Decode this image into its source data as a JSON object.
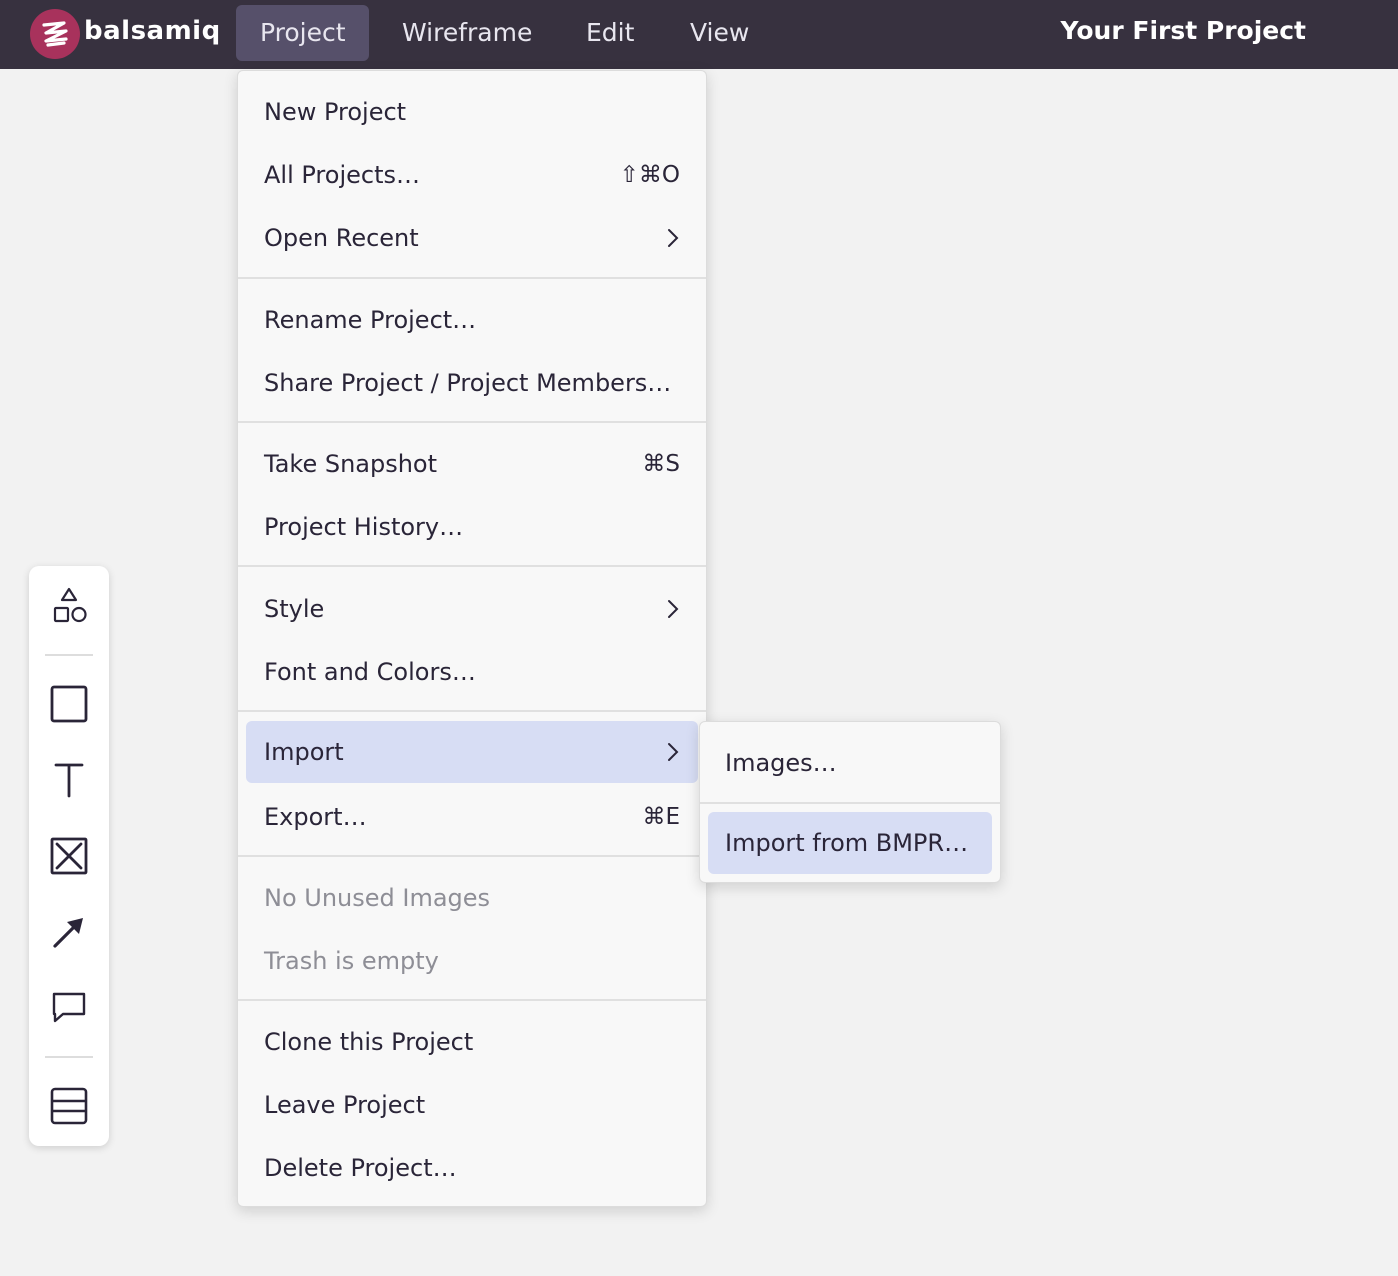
{
  "topbar": {
    "brand": "balsamiq",
    "menus": [
      "Project",
      "Wireframe",
      "Edit",
      "View"
    ],
    "active_menu": "Project",
    "project_title": "Your First Project"
  },
  "project_menu": {
    "new_project": "New Project",
    "all_projects": "All Projects…",
    "all_projects_shortcut": "⇧⌘O",
    "open_recent": "Open Recent",
    "rename_project": "Rename Project…",
    "share_project": "Share Project / Project Members…",
    "take_snapshot": "Take Snapshot",
    "take_snapshot_shortcut": "⌘S",
    "project_history": "Project History…",
    "style": "Style",
    "font_colors": "Font and Colors…",
    "import": "Import",
    "export": "Export…",
    "export_shortcut": "⌘E",
    "no_unused_images": "No Unused Images",
    "trash_empty": "Trash is empty",
    "clone_project": "Clone this Project",
    "leave_project": "Leave Project",
    "delete_project": "Delete Project…"
  },
  "import_submenu": {
    "images": "Images…",
    "import_bmpr": "Import from BMPR…"
  },
  "toolbar": {
    "tools": [
      "shapes-icon",
      "rectangle-icon",
      "text-icon",
      "image-placeholder-icon",
      "arrow-icon",
      "comment-icon",
      "layout-icon"
    ]
  },
  "colors": {
    "topbar_bg": "#37313f",
    "logo_accent": "#a8325c",
    "highlight": "#d7ddf4",
    "canvas_bg": "#f2f2f2"
  }
}
